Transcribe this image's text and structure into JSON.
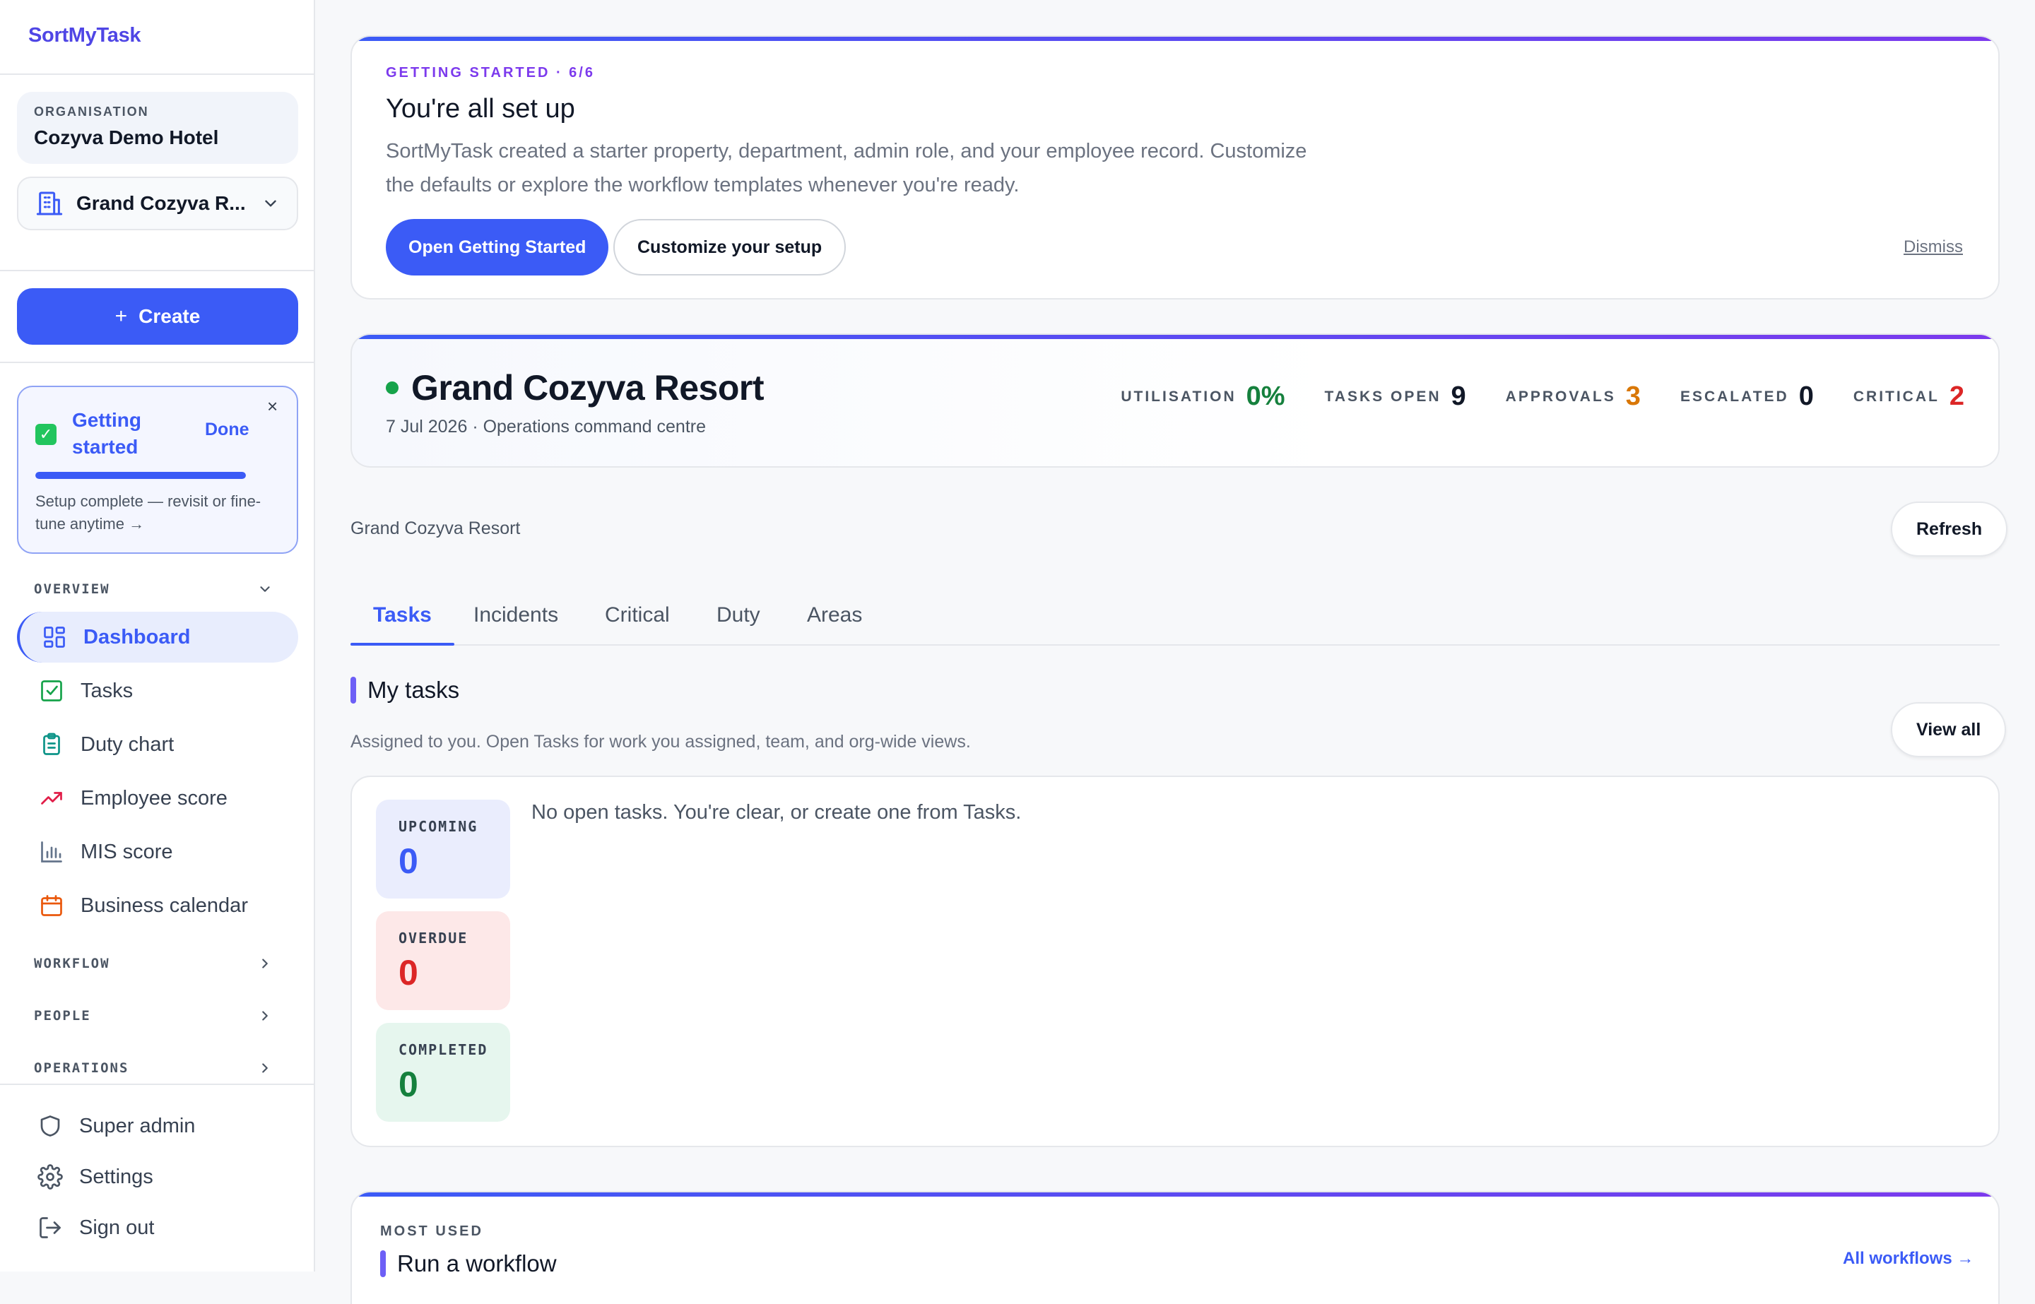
{
  "brand": "SortMyTask",
  "sidebar": {
    "org_label": "ORGANISATION",
    "org_name": "Cozyva Demo Hotel",
    "property": "Grand Cozyva R...",
    "create_label": "Create",
    "getting_started": {
      "title": "Getting started",
      "done_label": "Done",
      "close": "×",
      "progress": 1.0,
      "text": "Setup complete — revisit or fine-tune anytime →"
    },
    "sections": {
      "overview": "OVERVIEW",
      "workflow": "WORKFLOW",
      "people": "PEOPLE",
      "operations": "OPERATIONS"
    },
    "items": [
      {
        "label": "Dashboard",
        "icon": "dashboard-icon"
      },
      {
        "label": "Tasks",
        "icon": "checkbox-icon"
      },
      {
        "label": "Duty chart",
        "icon": "clipboard-icon"
      },
      {
        "label": "Employee score",
        "icon": "trending-up-icon"
      },
      {
        "label": "MIS score",
        "icon": "bar-chart-icon"
      },
      {
        "label": "Business calendar",
        "icon": "calendar-icon"
      }
    ],
    "bottom_items": [
      {
        "label": "Super admin",
        "icon": "shield-icon"
      },
      {
        "label": "Settings",
        "icon": "gear-icon"
      },
      {
        "label": "Sign out",
        "icon": "sign-out-icon"
      }
    ]
  },
  "setup_card": {
    "eyebrow": "GETTING STARTED · 6/6",
    "title": "You're all set up",
    "description": "SortMyTask created a starter property, department, admin role, and your employee record. Customize the defaults or explore the workflow templates whenever you're ready.",
    "primary_label": "Open Getting Started",
    "secondary_label": "Customize your setup",
    "dismiss_label": "Dismiss"
  },
  "property_card": {
    "title": "Grand Cozyva Resort",
    "subtitle": "7 Jul 2026 · Operations command centre",
    "kpis": [
      {
        "label": "UTILISATION",
        "value": "0%",
        "color": "#15803d"
      },
      {
        "label": "TASKS OPEN",
        "value": "9",
        "color": "#111827"
      },
      {
        "label": "APPROVALS",
        "value": "3",
        "color": "#d97706"
      },
      {
        "label": "ESCALATED",
        "value": "0",
        "color": "#111827"
      },
      {
        "label": "CRITICAL",
        "value": "2",
        "color": "#dc2626"
      }
    ]
  },
  "breadcrumb": "Grand Cozyva Resort",
  "refresh_label": "Refresh",
  "tabs": [
    "Tasks",
    "Incidents",
    "Critical",
    "Duty",
    "Areas"
  ],
  "my_tasks": {
    "title": "My tasks",
    "description": "Assigned to you. Open Tasks for work you assigned, team, and org-wide views.",
    "view_all_label": "View all",
    "empty_text": "No open tasks. You're clear, or create one from Tasks.",
    "stats": [
      {
        "label": "UPCOMING",
        "value": "0",
        "color": "#3b5bf6",
        "bg": "#eaedfd"
      },
      {
        "label": "OVERDUE",
        "value": "0",
        "color": "#dc2626",
        "bg": "#fde8e8"
      },
      {
        "label": "COMPLETED",
        "value": "0",
        "color": "#15803d",
        "bg": "#e6f6ee"
      }
    ]
  },
  "workflow_card": {
    "eyebrow": "MOST USED",
    "title": "Run a workflow",
    "link_label": "All workflows →"
  }
}
